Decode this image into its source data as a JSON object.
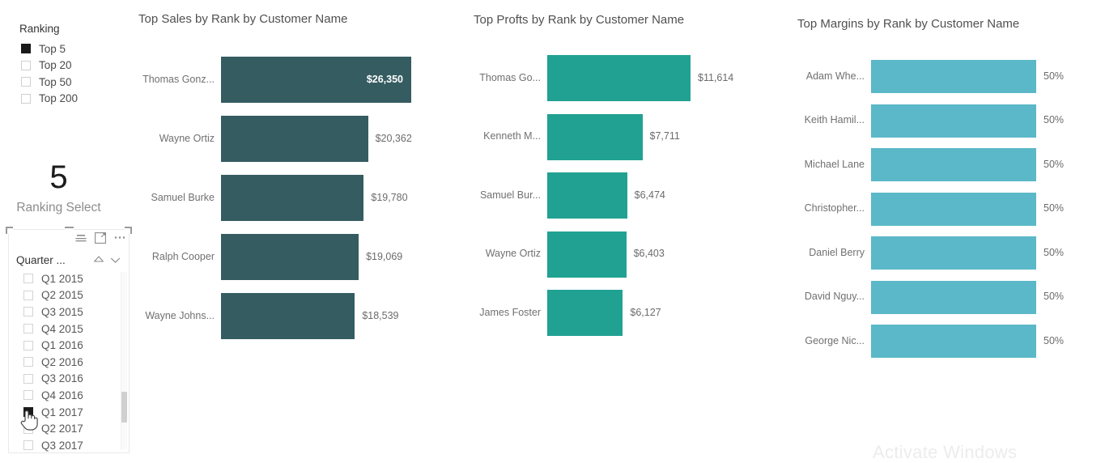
{
  "left_panel": {
    "ranking_title": "Ranking",
    "ranking_options": [
      {
        "label": "Top 5",
        "checked": true
      },
      {
        "label": "Top 20",
        "checked": false
      },
      {
        "label": "Top 50",
        "checked": false
      },
      {
        "label": "Top 200",
        "checked": false
      }
    ],
    "ranking_value": "5",
    "ranking_select_label": "Ranking Select",
    "slicer": {
      "field_label": "Quarter ...",
      "header_icons": [
        "filter-icon",
        "focus-mode-icon",
        "more-options-icon"
      ],
      "field_icons": [
        "clear-selections-icon",
        "expand-dropdown-icon"
      ],
      "items": [
        {
          "label": "Q1 2015",
          "checked": false
        },
        {
          "label": "Q2 2015",
          "checked": false
        },
        {
          "label": "Q3 2015",
          "checked": false
        },
        {
          "label": "Q4 2015",
          "checked": false
        },
        {
          "label": "Q1 2016",
          "checked": false
        },
        {
          "label": "Q2 2016",
          "checked": false
        },
        {
          "label": "Q3 2016",
          "checked": false
        },
        {
          "label": "Q4 2016",
          "checked": false
        },
        {
          "label": "Q1 2017",
          "checked": true
        },
        {
          "label": "Q2 2017",
          "checked": false
        },
        {
          "label": "Q3 2017",
          "checked": false
        }
      ]
    }
  },
  "watermark": "Activate Windows",
  "chart_data": [
    {
      "id": "sales",
      "type": "bar",
      "orientation": "horizontal",
      "title": "Top Sales by Rank by Customer Name",
      "xlabel": "",
      "ylabel": "",
      "bar_color": "#355c61",
      "grid": false,
      "legend": "none",
      "categories": [
        "Thomas Gonz...",
        "Wayne Ortiz",
        "Samuel Burke",
        "Ralph Cooper",
        "Wayne Johns..."
      ],
      "values": [
        26350,
        19780,
        19069,
        18539,
        18539
      ],
      "value_labels": [
        "$26,350",
        "$20,362",
        "$19,780",
        "$19,069",
        "$18,539"
      ],
      "bars": [
        {
          "category": "Thomas Gonz...",
          "value": 26350,
          "label": "$26,350",
          "label_inside": true
        },
        {
          "category": "Wayne Ortiz",
          "value": 20362,
          "label": "$20,362",
          "label_inside": false
        },
        {
          "category": "Samuel Burke",
          "value": 19780,
          "label": "$19,780",
          "label_inside": false
        },
        {
          "category": "Ralph Cooper",
          "value": 19069,
          "label": "$19,069",
          "label_inside": false
        },
        {
          "category": "Wayne Johns...",
          "value": 18539,
          "label": "$18,539",
          "label_inside": false
        }
      ]
    },
    {
      "id": "profits",
      "type": "bar",
      "orientation": "horizontal",
      "title": "Top Profts by Rank by Customer Name",
      "xlabel": "",
      "ylabel": "",
      "bar_color": "#21a192",
      "grid": false,
      "legend": "none",
      "categories": [
        "Thomas Go...",
        "Kenneth M...",
        "Samuel Bur...",
        "Wayne Ortiz",
        "James Foster"
      ],
      "values": [
        11614,
        7711,
        6474,
        6403,
        6127
      ],
      "value_labels": [
        "$11,614",
        "$7,711",
        "$6,474",
        "$6,403",
        "$6,127"
      ],
      "bars": [
        {
          "category": "Thomas Go...",
          "value": 11614,
          "label": "$11,614",
          "label_inside": false
        },
        {
          "category": "Kenneth M...",
          "value": 7711,
          "label": "$7,711",
          "label_inside": false
        },
        {
          "category": "Samuel Bur...",
          "value": 6474,
          "label": "$6,474",
          "label_inside": false
        },
        {
          "category": "Wayne Ortiz",
          "value": 6403,
          "label": "$6,403",
          "label_inside": false
        },
        {
          "category": "James Foster",
          "value": 6127,
          "label": "$6,127",
          "label_inside": false
        }
      ]
    },
    {
      "id": "margins",
      "type": "bar",
      "orientation": "horizontal",
      "title": "Top Margins by Rank by Customer Name",
      "xlabel": "",
      "ylabel": "",
      "bar_color": "#5bb8c8",
      "grid": false,
      "legend": "none",
      "categories": [
        "Adam Whe...",
        "Keith Hamil...",
        "Michael Lane",
        "Christopher...",
        "Daniel Berry",
        "David Nguy...",
        "George Nic..."
      ],
      "values": [
        50,
        50,
        50,
        50,
        50,
        50,
        50
      ],
      "value_labels": [
        "50%",
        "50%",
        "50%",
        "50%",
        "50%",
        "50%",
        "50%"
      ],
      "bars": [
        {
          "category": "Adam Whe...",
          "value": 50,
          "label": "50%",
          "label_inside": false
        },
        {
          "category": "Keith Hamil...",
          "value": 50,
          "label": "50%",
          "label_inside": false
        },
        {
          "category": "Michael Lane",
          "value": 50,
          "label": "50%",
          "label_inside": false
        },
        {
          "category": "Christopher...",
          "value": 50,
          "label": "50%",
          "label_inside": false
        },
        {
          "category": "Daniel Berry",
          "value": 50,
          "label": "50%",
          "label_inside": false
        },
        {
          "category": "David Nguy...",
          "value": 50,
          "label": "50%",
          "label_inside": false
        },
        {
          "category": "George Nic...",
          "value": 50,
          "label": "50%",
          "label_inside": false
        }
      ]
    }
  ]
}
